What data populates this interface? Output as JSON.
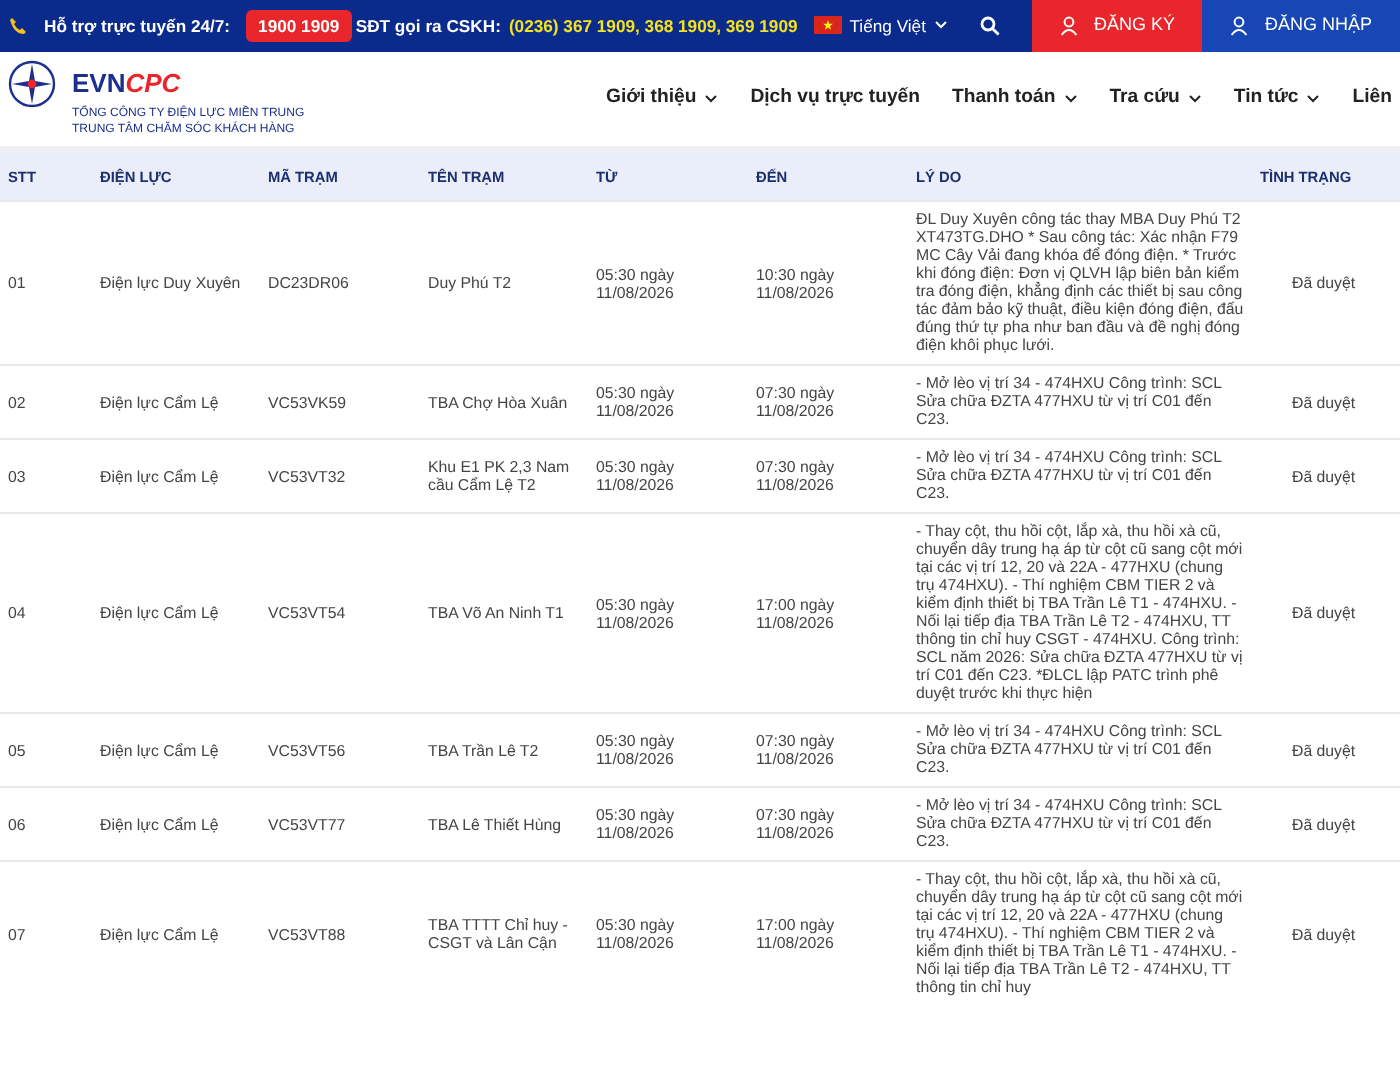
{
  "topbar": {
    "support_label": "Hỗ trợ trực tuyến 24/7:",
    "support_phone": "1900 1909",
    "cskh_label": "SĐT gọi ra CSKH:",
    "cskh_numbers": "(0236) 367 1909, 368 1909, 369 1909",
    "language": "Tiếng Việt",
    "register": "ĐĂNG KÝ",
    "login": "ĐĂNG NHẬP"
  },
  "brand": {
    "wordmark_a": "EVN",
    "wordmark_b": "CPC",
    "line1": "TỔNG CÔNG TY ĐIỆN LỰC MIỀN TRUNG",
    "line2": "TRUNG TÂM CHĂM SÓC KHÁCH HÀNG"
  },
  "nav": [
    {
      "label": "Giới thiệu",
      "has_dropdown": true
    },
    {
      "label": "Dịch vụ trực tuyến",
      "has_dropdown": false
    },
    {
      "label": "Thanh toán",
      "has_dropdown": true
    },
    {
      "label": "Tra cứu",
      "has_dropdown": true
    },
    {
      "label": "Tin tức",
      "has_dropdown": true
    },
    {
      "label": "Liên",
      "has_dropdown": false
    }
  ],
  "table": {
    "columns": [
      "STT",
      "ĐIỆN LỰC",
      "MÃ TRẠM",
      "TÊN TRẠM",
      "TỪ",
      "ĐẾN",
      "LÝ DO",
      "TÌNH TRẠNG"
    ],
    "rows": [
      [
        "01",
        "Điện lực Duy Xuyên",
        "DC23DR06",
        "Duy Phú T2",
        "05:30 ngày 11/08/2026",
        "10:30 ngày 11/08/2026",
        "ĐL Duy Xuyên công tác thay MBA Duy Phú T2 XT473TG.DHO * Sau công tác: Xác nhận F79 MC Cây Vải đang khóa để đóng điện. * Trước khi đóng điện: Đơn vị QLVH lập biên bản kiểm tra đóng điện, khẳng định các thiết bị sau công tác đảm bảo kỹ thuật, điều kiện đóng điện, đấu đúng thứ tự pha như ban đầu và đề nghị đóng điện khôi phục lưới.",
        "Đã duyệt"
      ],
      [
        "02",
        "Điện lực Cẩm Lệ",
        "VC53VK59",
        "TBA Chợ Hòa Xuân",
        "05:30 ngày 11/08/2026",
        "07:30 ngày 11/08/2026",
        "- Mở lèo vị trí 34 - 474HXU Công trình: SCL Sửa chữa ĐZTA 477HXU từ vị trí C01 đến C23.",
        "Đã duyệt"
      ],
      [
        "03",
        "Điện lực Cẩm Lệ",
        "VC53VT32",
        "Khu E1 PK 2,3 Nam cầu Cẩm Lệ T2",
        "05:30 ngày 11/08/2026",
        "07:30 ngày 11/08/2026",
        "- Mở lèo vị trí 34 - 474HXU Công trình: SCL Sửa chữa ĐZTA 477HXU từ vị trí C01 đến C23.",
        "Đã duyệt"
      ],
      [
        "04",
        "Điện lực Cẩm Lệ",
        "VC53VT54",
        "TBA Võ An Ninh T1",
        "05:30 ngày 11/08/2026",
        "17:00 ngày 11/08/2026",
        "- Thay cột, thu hồi cột, lắp xà, thu hồi xà cũ, chuyển dây trung hạ áp từ cột cũ sang cột mới tại các vị trí 12, 20 và 22A - 477HXU (chung trụ 474HXU). - Thí nghiệm CBM TIER 2 và kiểm định thiết bị TBA Trần Lê T1 - 474HXU. - Nối lại tiếp địa TBA Trần Lê T2 - 474HXU, TT thông tin chỉ huy CSGT - 474HXU. Công trình: SCL năm 2026: Sửa chữa ĐZTA 477HXU từ vị trí C01 đến C23. *ĐLCL lập PATC trình phê duyệt trước khi thực hiện",
        "Đã duyệt"
      ],
      [
        "05",
        "Điện lực Cẩm Lệ",
        "VC53VT56",
        "TBA Trần Lê T2",
        "05:30 ngày 11/08/2026",
        "07:30 ngày 11/08/2026",
        "- Mở lèo vị trí 34 - 474HXU Công trình: SCL Sửa chữa ĐZTA 477HXU từ vị trí C01 đến C23.",
        "Đã duyệt"
      ],
      [
        "06",
        "Điện lực Cẩm Lệ",
        "VC53VT77",
        "TBA Lê Thiết Hùng",
        "05:30 ngày 11/08/2026",
        "07:30 ngày 11/08/2026",
        "- Mở lèo vị trí 34 - 474HXU Công trình: SCL Sửa chữa ĐZTA 477HXU từ vị trí C01 đến C23.",
        "Đã duyệt"
      ],
      [
        "07",
        "Điện lực Cẩm Lệ",
        "VC53VT88",
        "TBA TTTT Chỉ huy - CSGT và Lân Cận",
        "05:30 ngày 11/08/2026",
        "17:00 ngày 11/08/2026",
        "- Thay cột, thu hồi cột, lắp xà, thu hồi xà cũ, chuyển dây trung hạ áp từ cột cũ sang cột mới tại các vị trí 12, 20 và 22A - 477HXU (chung trụ 474HXU). - Thí nghiệm CBM TIER 2 và kiểm định thiết bị TBA Trần Lê T1 - 474HXU. - Nối lại tiếp địa TBA Trần Lê T2 - 474HXU, TT thông tin chỉ huy",
        "Đã duyệt"
      ]
    ]
  }
}
